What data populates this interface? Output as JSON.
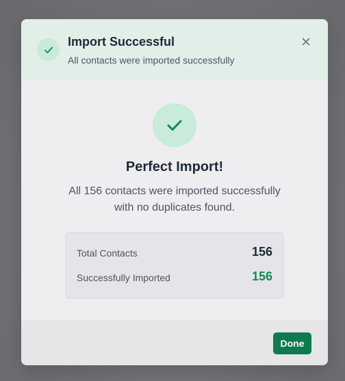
{
  "dialog": {
    "title": "Import Successful",
    "subtitle": "All contacts were imported successfully",
    "close_icon": "close-icon",
    "header_icon": "check-icon"
  },
  "result": {
    "icon": "check-circle-icon",
    "title": "Perfect Import!",
    "message": "All 156 contacts were imported successfully with no duplicates found."
  },
  "stats": [
    {
      "label": "Total Contacts",
      "value": "156"
    },
    {
      "label": "Successfully Imported",
      "value": "156"
    }
  ],
  "footer": {
    "done_label": "Done"
  },
  "colors": {
    "accent": "#0e7a4f",
    "success_text": "#128a5c",
    "header_bg": "#e2efe9",
    "icon_bg": "#c8ebda"
  }
}
